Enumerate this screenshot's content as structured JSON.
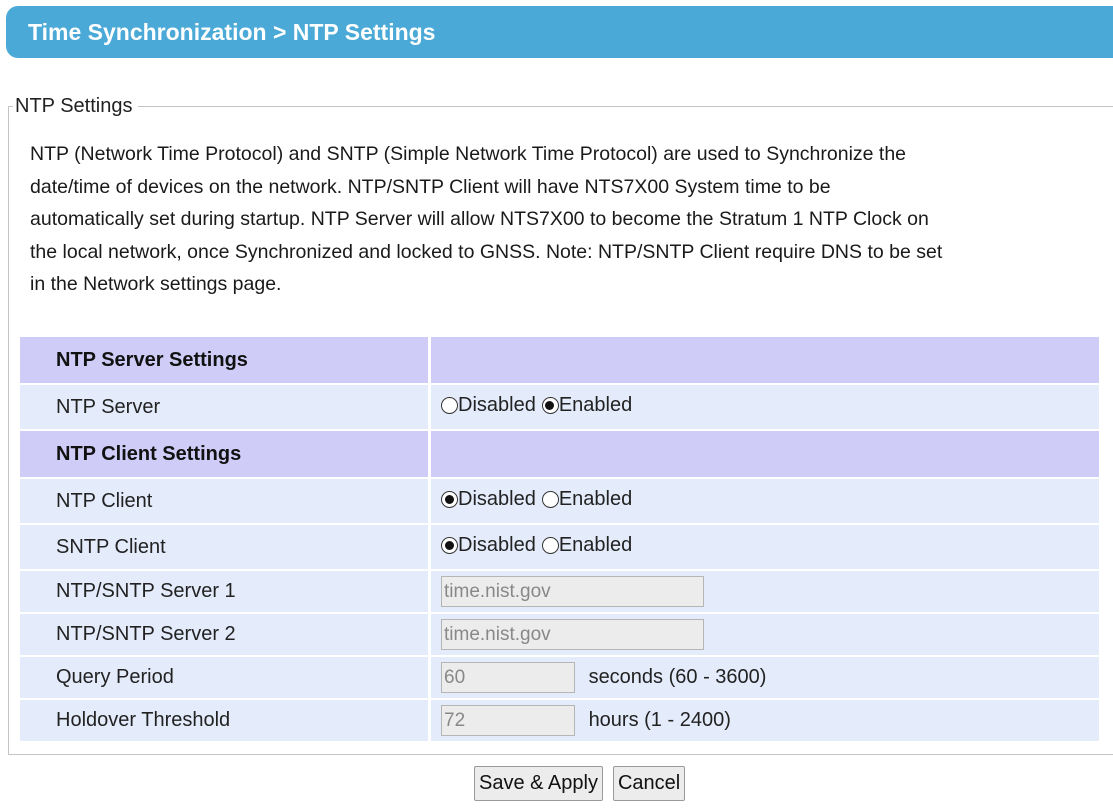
{
  "header": {
    "title": "Time Synchronization > NTP Settings"
  },
  "section": {
    "legend": "NTP Settings",
    "description": [
      "NTP (Network Time Protocol) and SNTP (Simple Network Time Protocol) are used to Synchronize the",
      "date/time of devices on the network. NTP/SNTP Client will have NTS7X00 System time to be",
      "automatically set during startup. NTP Server will allow NTS7X00 to become the Stratum 1 NTP Clock on",
      "the local network, once Synchronized and locked to GNSS. Note: NTP/SNTP Client require DNS to be set",
      "in the Network settings page."
    ]
  },
  "server_settings": {
    "header": "NTP Server Settings",
    "ntp_server": {
      "label": "NTP Server",
      "option_disabled": "Disabled",
      "option_enabled": "Enabled",
      "selected": "Enabled"
    }
  },
  "client_settings": {
    "header": "NTP Client Settings",
    "ntp_client": {
      "label": "NTP Client",
      "option_disabled": "Disabled",
      "option_enabled": "Enabled",
      "selected": "Disabled"
    },
    "sntp_client": {
      "label": "SNTP Client",
      "option_disabled": "Disabled",
      "option_enabled": "Enabled",
      "selected": "Disabled"
    },
    "server1": {
      "label": "NTP/SNTP Server 1",
      "value": "time.nist.gov"
    },
    "server2": {
      "label": "NTP/SNTP Server 2",
      "value": "time.nist.gov"
    },
    "query_period": {
      "label": "Query Period",
      "value": "60",
      "unit": "seconds (60 - 3600)"
    },
    "holdover": {
      "label": "Holdover Threshold",
      "value": "72",
      "unit": "hours (1 - 2400)"
    }
  },
  "buttons": {
    "save": "Save & Apply",
    "cancel": "Cancel"
  }
}
